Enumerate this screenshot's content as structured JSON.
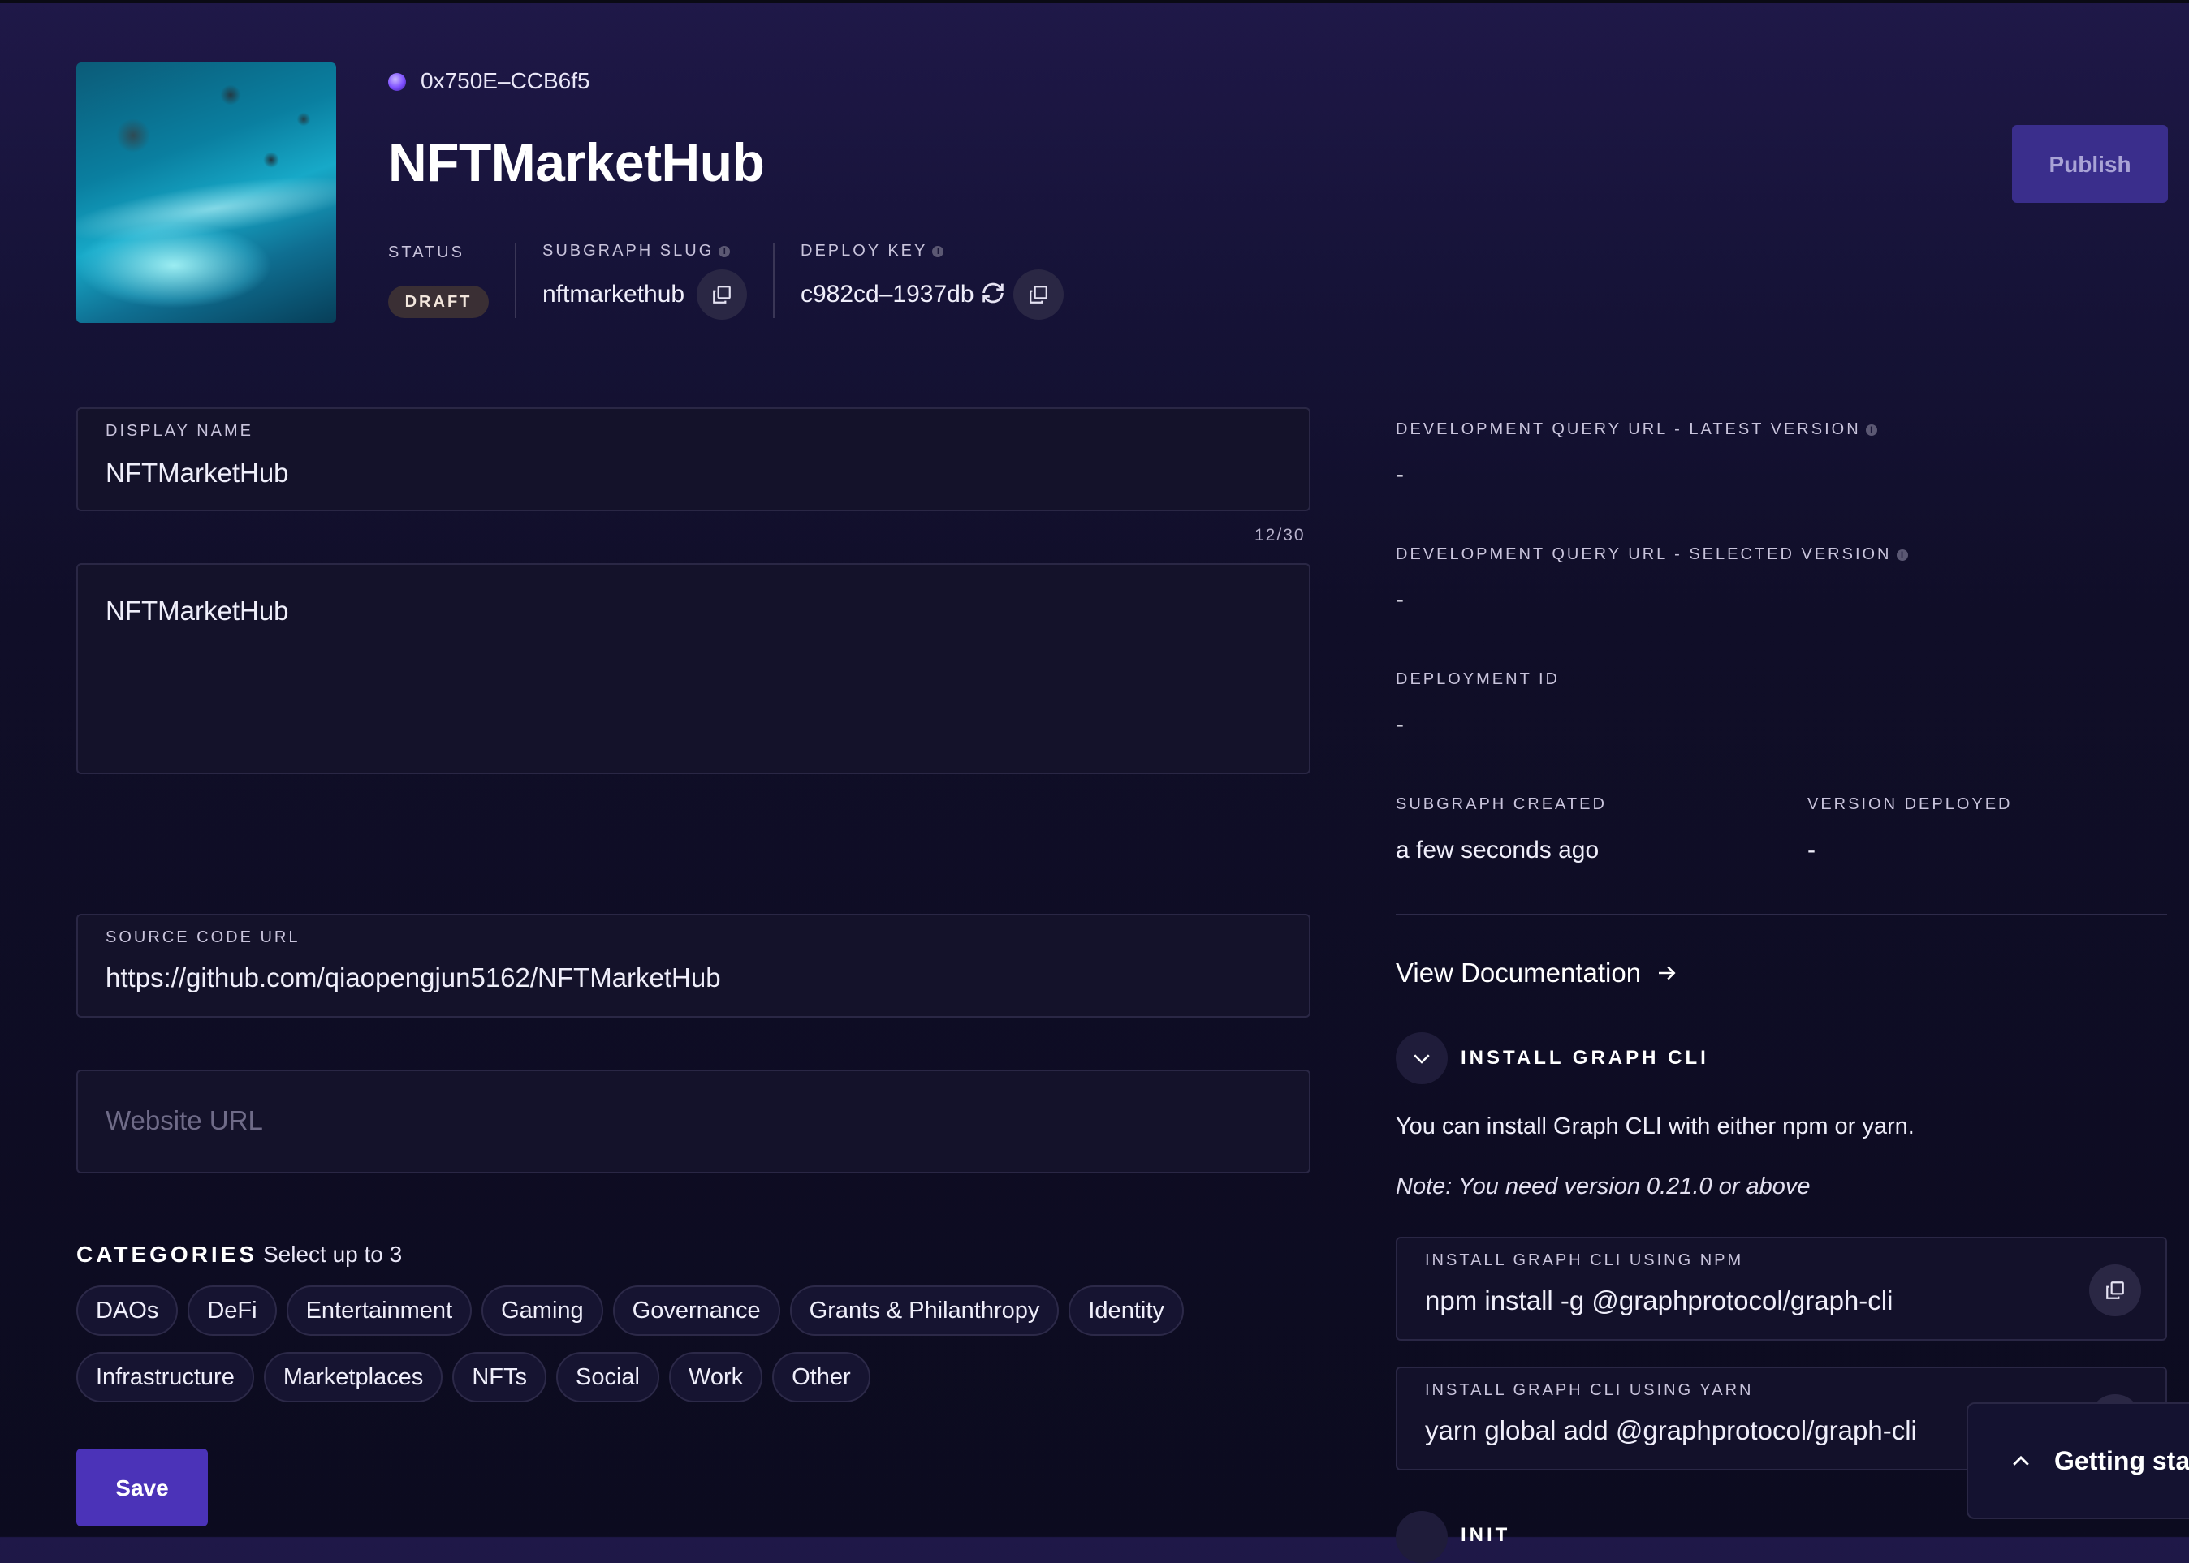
{
  "header": {
    "address": "0x750E–CCB6f5",
    "title": "NFTMarketHub",
    "status_label": "STATUS",
    "status_value": "DRAFT",
    "slug_label": "SUBGRAPH SLUG",
    "slug_value": "nftmarkethub",
    "deploy_key_label": "DEPLOY KEY",
    "deploy_key_value": "c982cd–1937db",
    "publish_label": "Publish"
  },
  "form": {
    "display_name_label": "DISPLAY NAME",
    "display_name_value": "NFTMarketHub",
    "counter": "12/30",
    "description_value": "NFTMarketHub",
    "source_code_label": "SOURCE CODE URL",
    "source_code_value": "https://github.com/qiaopengjun5162/NFTMarketHub",
    "website_placeholder": "Website URL",
    "categories_heading": "CATEGORIES",
    "categories_hint": "Select up to 3",
    "categories_row1": [
      "DAOs",
      "DeFi",
      "Entertainment",
      "Gaming",
      "Governance",
      "Grants & Philanthropy",
      "Identity"
    ],
    "categories_row2": [
      "Infrastructure",
      "Marketplaces",
      "NFTs",
      "Social",
      "Work",
      "Other"
    ],
    "save_label": "Save"
  },
  "details": {
    "dev_url_latest_label": "DEVELOPMENT QUERY URL - LATEST VERSION",
    "dev_url_latest_value": "-",
    "dev_url_selected_label": "DEVELOPMENT QUERY URL - SELECTED VERSION",
    "dev_url_selected_value": "-",
    "deployment_id_label": "DEPLOYMENT ID",
    "deployment_id_value": "-",
    "created_label": "SUBGRAPH CREATED",
    "created_value": "a few seconds ago",
    "version_deployed_label": "VERSION DEPLOYED",
    "version_deployed_value": "-",
    "view_docs": "View Documentation",
    "install_section_title": "INSTALL GRAPH CLI",
    "install_text": "You can install Graph CLI with either npm or yarn.",
    "install_note": "Note: You need version 0.21.0 or above",
    "npm_label": "INSTALL GRAPH CLI USING NPM",
    "npm_command": "npm install -g @graphprotocol/graph-cli",
    "yarn_label": "INSTALL GRAPH CLI USING YARN",
    "yarn_command": "yarn global add @graphprotocol/graph-cli",
    "next_section_title": "INIT"
  },
  "toast": {
    "label": "Getting sta"
  },
  "icons": {
    "info": "info-icon",
    "copy": "copy-icon",
    "refresh": "refresh-icon",
    "chevron_down": "chevron-down-icon",
    "chevron_up": "chevron-up-icon",
    "arrow_right": "arrow-right-icon"
  },
  "colors": {
    "accent": "#4b33b8",
    "publish_disabled": "#3a2e8c",
    "draft_badge": "#3a2f34"
  }
}
